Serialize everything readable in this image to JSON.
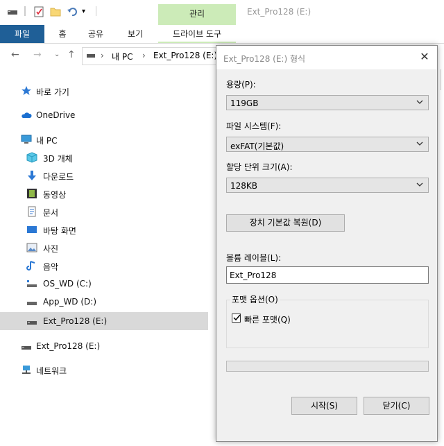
{
  "ribbon": {
    "manage_tab": "관리",
    "window_title": "Ext_Pro128 (E:)",
    "tabs": {
      "file": "파일",
      "home": "홈",
      "share": "공유",
      "view": "보기",
      "drive_tools": "드라이브 도구"
    }
  },
  "address": {
    "this_pc": "내 PC",
    "current": "Ext_Pro128 (E:)",
    "separator": "›"
  },
  "sidebar": {
    "items": [
      {
        "label": "바로 가기",
        "icon": "star-icon"
      },
      {
        "label": "OneDrive",
        "icon": "cloud-icon"
      },
      {
        "label": "내 PC",
        "icon": "computer-icon"
      },
      {
        "label": "3D 개체",
        "icon": "cube-icon"
      },
      {
        "label": "다운로드",
        "icon": "download-icon"
      },
      {
        "label": "동영상",
        "icon": "video-icon"
      },
      {
        "label": "문서",
        "icon": "document-icon"
      },
      {
        "label": "바탕 화면",
        "icon": "desktop-icon"
      },
      {
        "label": "사진",
        "icon": "picture-icon"
      },
      {
        "label": "음악",
        "icon": "music-icon"
      },
      {
        "label": "OS_WD (C:)",
        "icon": "os-drive-icon"
      },
      {
        "label": "App_WD (D:)",
        "icon": "drive-icon"
      },
      {
        "label": "Ext_Pro128 (E:)",
        "icon": "usb-drive-icon"
      },
      {
        "label": "Ext_Pro128 (E:)",
        "icon": "usb-drive-icon"
      },
      {
        "label": "네트워크",
        "icon": "network-icon"
      }
    ]
  },
  "dialog": {
    "title": "Ext_Pro128 (E:) 형식",
    "close_glyph": "✕",
    "capacity_label": "용량(P):",
    "capacity_value": "119GB",
    "fs_label": "파일 시스템(F):",
    "fs_value": "exFAT(기본값)",
    "unit_label": "할당 단위 크기(A):",
    "unit_value": "128KB",
    "restore_button": "장치 기본값 복원(D)",
    "volume_label": "볼륨 레이블(L):",
    "volume_value": "Ext_Pro128",
    "format_options": "포맷 옵션(O)",
    "quick_format": "빠른 포맷(Q)",
    "quick_format_checked": true,
    "progress": 0,
    "start_button": "시작(S)",
    "close_button": "닫기(C)"
  },
  "colors": {
    "accent_file_tab": "#1f5f97",
    "manage_tab": "#ccebb8",
    "selected_nav": "#d9d9d9"
  }
}
